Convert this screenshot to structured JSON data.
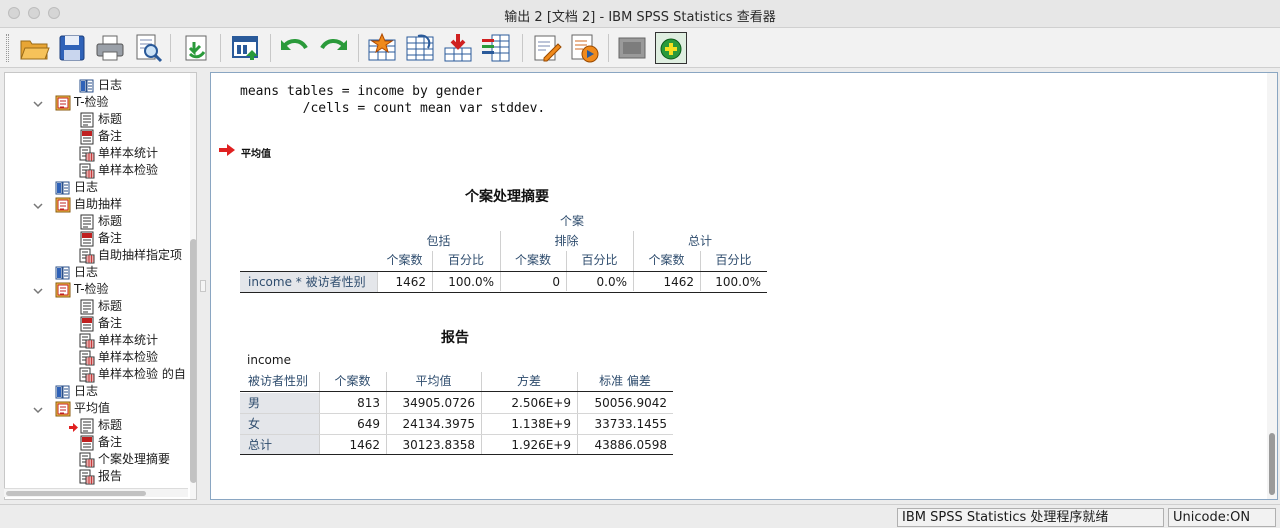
{
  "window": {
    "title": "输出 2 [文档 2] - IBM SPSS Statistics 查看器"
  },
  "toolbar": {
    "buttons": [
      {
        "name": "open-icon"
      },
      {
        "name": "save-icon"
      },
      {
        "name": "print-icon"
      },
      {
        "name": "print-preview-icon"
      },
      {
        "name": "export-icon"
      },
      {
        "name": "recall-dialog-icon"
      },
      {
        "name": "undo-icon"
      },
      {
        "name": "redo-icon"
      },
      {
        "name": "goto-data-icon"
      },
      {
        "name": "goto-case-icon"
      },
      {
        "name": "goto-variable-icon"
      },
      {
        "name": "variables-icon"
      },
      {
        "name": "designate-window-icon"
      },
      {
        "name": "run-script-icon"
      },
      {
        "name": "show-all-icon"
      },
      {
        "name": "insert-output-icon"
      }
    ]
  },
  "nav_tree": {
    "items": [
      {
        "label": "日志",
        "level": 2,
        "icon": "log-icon"
      },
      {
        "label": "T-检验",
        "level": 1,
        "icon": "procedure-icon",
        "expanded": true
      },
      {
        "label": "标题",
        "level": 2,
        "icon": "title-icon"
      },
      {
        "label": "备注",
        "level": 2,
        "icon": "notes-icon"
      },
      {
        "label": "单样本统计",
        "level": 2,
        "icon": "table-icon"
      },
      {
        "label": "单样本检验",
        "level": 2,
        "icon": "table-icon"
      },
      {
        "label": "日志",
        "level": 1,
        "icon": "log-icon"
      },
      {
        "label": "自助抽样",
        "level": 1,
        "icon": "procedure-icon",
        "expanded": true
      },
      {
        "label": "标题",
        "level": 2,
        "icon": "title-icon"
      },
      {
        "label": "备注",
        "level": 2,
        "icon": "notes-icon"
      },
      {
        "label": "自助抽样指定项",
        "level": 2,
        "icon": "table-icon"
      },
      {
        "label": "日志",
        "level": 1,
        "icon": "log-icon"
      },
      {
        "label": "T-检验",
        "level": 1,
        "icon": "procedure-icon",
        "expanded": true
      },
      {
        "label": "标题",
        "level": 2,
        "icon": "title-icon"
      },
      {
        "label": "备注",
        "level": 2,
        "icon": "notes-icon"
      },
      {
        "label": "单样本统计",
        "level": 2,
        "icon": "table-icon"
      },
      {
        "label": "单样本检验",
        "level": 2,
        "icon": "table-icon"
      },
      {
        "label": "单样本检验 的自",
        "level": 2,
        "icon": "table-icon"
      },
      {
        "label": "日志",
        "level": 1,
        "icon": "log-icon"
      },
      {
        "label": "平均值",
        "level": 1,
        "icon": "procedure-icon",
        "expanded": true
      },
      {
        "label": "标题",
        "level": 2,
        "icon": "title-icon",
        "current": true
      },
      {
        "label": "备注",
        "level": 2,
        "icon": "notes-icon"
      },
      {
        "label": "个案处理摘要",
        "level": 2,
        "icon": "table-icon"
      },
      {
        "label": "报告",
        "level": 2,
        "icon": "table-icon"
      }
    ]
  },
  "output": {
    "syntax_lines": [
      "means tables = income by gender",
      "        /cells = count mean var stddev."
    ],
    "section_title": "平均值",
    "case_summary": {
      "title": "个案处理摘要",
      "super_header": "个案",
      "groups": [
        "包括",
        "排除",
        "总计"
      ],
      "subcols": [
        "个案数",
        "百分比",
        "个案数",
        "百分比",
        "个案数",
        "百分比"
      ],
      "row_label": "income   * 被访者性别",
      "row_values": [
        "1462",
        "100.0%",
        "0",
        "0.0%",
        "1462",
        "100.0%"
      ]
    },
    "report": {
      "title": "报告",
      "dependent": "income",
      "columns": [
        "被访者性别",
        "个案数",
        "平均值",
        "方差",
        "标准 偏差"
      ],
      "rows": [
        {
          "label": "男",
          "values": [
            "813",
            "34905.0726",
            "2.506E+9",
            "50056.9042"
          ]
        },
        {
          "label": "女",
          "values": [
            "649",
            "24134.3975",
            "1.138E+9",
            "33733.1455"
          ]
        },
        {
          "label": "总计",
          "values": [
            "1462",
            "30123.8358",
            "1.926E+9",
            "43886.0598"
          ]
        }
      ]
    }
  },
  "status": {
    "processor": "IBM SPSS Statistics 处理程序就绪",
    "unicode": "Unicode:ON"
  },
  "colors": {
    "header_text": "#2f4d6e",
    "row_shade": "#e4e6ea",
    "arrow_red": "#e02020"
  }
}
